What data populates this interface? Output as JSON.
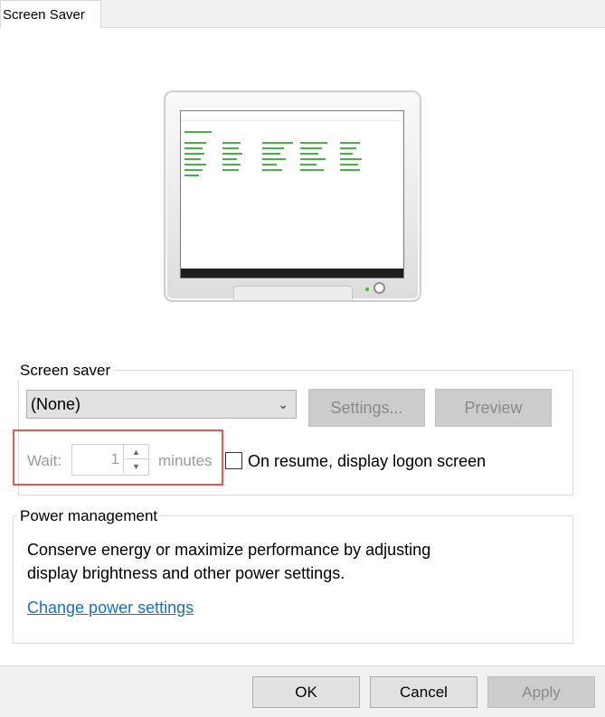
{
  "tab": {
    "label": "Screen Saver"
  },
  "screen_saver": {
    "group_title": "Screen saver",
    "selected": "(None)",
    "settings_label": "Settings...",
    "preview_label": "Preview",
    "wait_label": "Wait:",
    "wait_value": "1",
    "minutes_label": "minutes",
    "resume_label": "On resume, display logon screen"
  },
  "power": {
    "group_title": "Power management",
    "line1": "Conserve energy or maximize performance by adjusting",
    "line2": "display brightness and other power settings.",
    "link": "Change power settings"
  },
  "buttons": {
    "ok": "OK",
    "cancel": "Cancel",
    "apply": "Apply"
  }
}
